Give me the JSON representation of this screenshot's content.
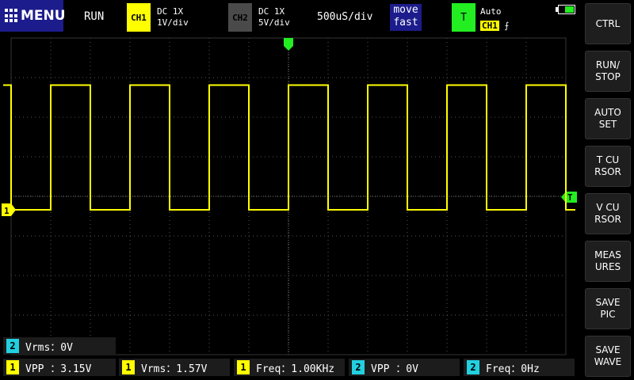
{
  "header": {
    "menu_label": "MENU",
    "run_state": "RUN",
    "ch1": {
      "label": "CH1",
      "coupling": "DC  1X",
      "scale": "1V/div",
      "color": "#ffff00"
    },
    "ch2": {
      "label": "CH2",
      "coupling": "DC  1X",
      "scale": "5V/div",
      "color": "#4a4a4a"
    },
    "timebase": "500uS/div",
    "move_mode": [
      "move",
      "fast"
    ],
    "trigger": {
      "label": "T",
      "mode": "Auto",
      "source": "CH1",
      "edge": "⨍"
    },
    "battery_level": 0.6
  },
  "side_buttons": [
    {
      "name": "ctrl-button",
      "label": "CTRL"
    },
    {
      "name": "run-stop-button",
      "label": "RUN/\nSTOP"
    },
    {
      "name": "auto-set-button",
      "label": "AUTO\nSET"
    },
    {
      "name": "t-cursor-button",
      "label": "T CU\nRSOR"
    },
    {
      "name": "v-cursor-button",
      "label": "V CU\nRSOR"
    },
    {
      "name": "measures-button",
      "label": "MEAS\nURES"
    },
    {
      "name": "save-pic-button",
      "label": "SAVE\nPIC"
    },
    {
      "name": "save-wave-button",
      "label": "SAVE\nWAVE"
    }
  ],
  "markers": {
    "ch1_marker": "1",
    "trigger_marker": "T"
  },
  "measurements": [
    {
      "channel": "2",
      "color": "cyan",
      "text": "Vrms：0V"
    },
    {
      "channel": "1",
      "color": "yellow",
      "text": "VPP ：3.15V"
    },
    {
      "channel": "1",
      "color": "yellow",
      "text": "Vrms：1.57V"
    },
    {
      "channel": "1",
      "color": "yellow",
      "text": "Freq：1.00KHz"
    },
    {
      "channel": "2",
      "color": "cyan",
      "text": "VPP ：0V"
    },
    {
      "channel": "2",
      "color": "cyan",
      "text": "Freq：0Hz"
    }
  ],
  "waveform": {
    "channel": "CH1",
    "type": "square",
    "frequency_hz": 1000,
    "vpp": 3.15,
    "trace_color": "#ffff00"
  }
}
